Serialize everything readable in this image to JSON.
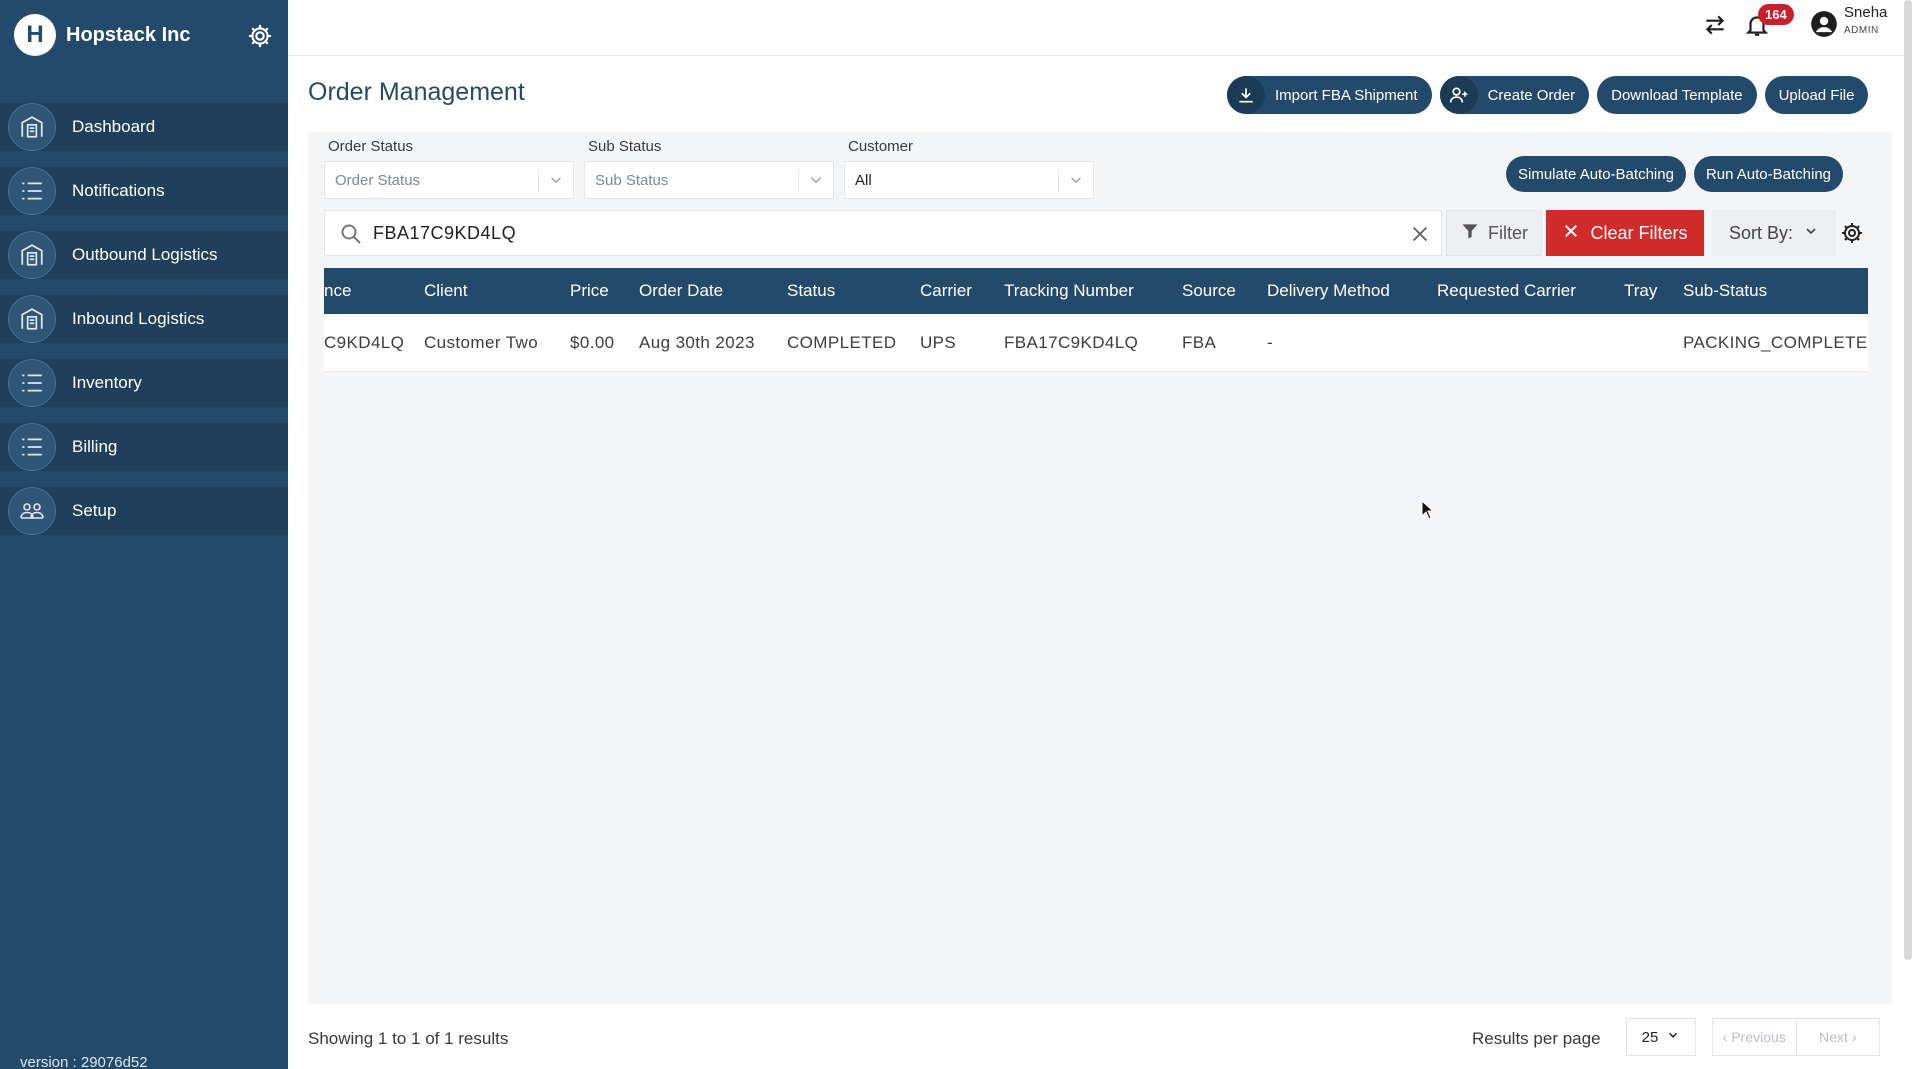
{
  "sidebar": {
    "brand": "Hopstack Inc",
    "brand_initial": "H",
    "items": [
      {
        "label": "Dashboard",
        "icon": "building-icon"
      },
      {
        "label": "Notifications",
        "icon": "list-icon"
      },
      {
        "label": "Outbound Logistics",
        "icon": "building-icon"
      },
      {
        "label": "Inbound Logistics",
        "icon": "building-icon"
      },
      {
        "label": "Inventory",
        "icon": "list-icon"
      },
      {
        "label": "Billing",
        "icon": "list-icon"
      },
      {
        "label": "Setup",
        "icon": "people-icon"
      }
    ],
    "version": "version : 29076d52"
  },
  "topbar": {
    "notification_count": "164",
    "user_name": "Sneha",
    "user_role": "ADMIN"
  },
  "page": {
    "title": "Order Management"
  },
  "actions": {
    "import_fba": "Import FBA Shipment",
    "create_order": "Create Order",
    "download_template": "Download Template",
    "upload_file": "Upload File",
    "simulate_auto_batching": "Simulate Auto-Batching",
    "run_auto_batching": "Run Auto-Batching"
  },
  "filters": {
    "order_status_label": "Order Status",
    "order_status_placeholder": "Order Status",
    "sub_status_label": "Sub Status",
    "sub_status_placeholder": "Sub Status",
    "customer_label": "Customer",
    "customer_value": "All"
  },
  "search": {
    "value": "FBA17C9KD4LQ"
  },
  "toolbar": {
    "filter": "Filter",
    "clear_filters": "Clear Filters",
    "sort_by": "Sort By:"
  },
  "table": {
    "columns": [
      "nce",
      "Client",
      "Price",
      "Order Date",
      "Status",
      "Carrier",
      "Tracking Number",
      "Source",
      "Delivery Method",
      "Requested Carrier",
      "Tray",
      "Sub-Status"
    ],
    "rows": [
      [
        "C9KD4LQ",
        "Customer Two",
        "$0.00",
        "Aug 30th 2023",
        "COMPLETED",
        "UPS",
        "FBA17C9KD4LQ",
        "FBA",
        "-",
        "",
        "",
        "PACKING_COMPLETE"
      ]
    ]
  },
  "footer": {
    "showing": "Showing 1 to 1 of 1 results",
    "results_per_page_label": "Results per page",
    "results_per_page_value": "25",
    "previous": "Previous",
    "next": "Next"
  },
  "colors": {
    "sidebar": "#244a6b",
    "accent": "#244a6b",
    "danger": "#d22b2b",
    "badge": "#c8202a"
  }
}
